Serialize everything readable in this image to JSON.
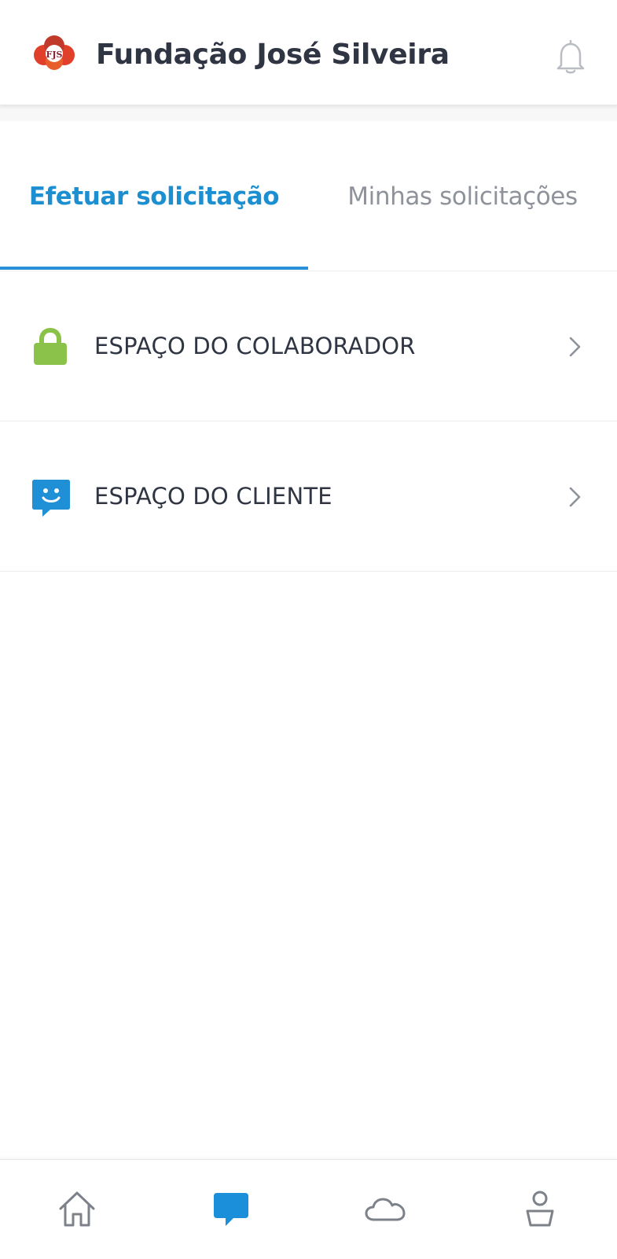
{
  "header": {
    "title": "Fundação José Silveira",
    "logo_letters": "FJS",
    "notification_icon": "bell-icon"
  },
  "tabs": [
    {
      "label": "Efetuar solicitação",
      "active": true
    },
    {
      "label": "Minhas solicitações",
      "active": false
    }
  ],
  "items": [
    {
      "label": "ESPAÇO DO COLABORADOR",
      "icon": "lock-icon",
      "icon_color": "#8bc34a"
    },
    {
      "label": "ESPAÇO DO CLIENTE",
      "icon": "smiley-chat-icon",
      "icon_color": "#1f8fd6"
    }
  ],
  "bottom_nav": {
    "items": [
      {
        "icon": "home-icon",
        "active": false
      },
      {
        "icon": "chat-icon",
        "active": true
      },
      {
        "icon": "cloud-icon",
        "active": false
      },
      {
        "icon": "user-icon",
        "active": false
      }
    ]
  },
  "colors": {
    "accent": "#1c8fd1",
    "tab_indicator": "#2a8fdb",
    "text": "#2f3542",
    "muted": "#8e929a",
    "lock_green": "#8bc34a",
    "logo_red": "#e0402a"
  }
}
